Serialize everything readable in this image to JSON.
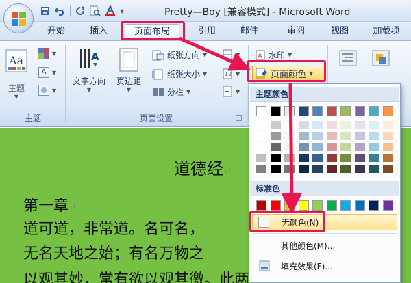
{
  "window": {
    "title": "Pretty—Boy [兼容模式] - Microsoft Word"
  },
  "quick_access": [
    "save-icon",
    "undo-icon",
    "redo-icon",
    "print-preview-icon",
    "font-color-icon"
  ],
  "tabs": [
    {
      "label": "开始",
      "active": false
    },
    {
      "label": "插入",
      "active": false
    },
    {
      "label": "页面布局",
      "active": true
    },
    {
      "label": "引用",
      "active": false
    },
    {
      "label": "邮件",
      "active": false
    },
    {
      "label": "审阅",
      "active": false
    },
    {
      "label": "视图",
      "active": false
    },
    {
      "label": "加载项",
      "active": false
    }
  ],
  "ribbon": {
    "theme_group": {
      "label": "主题",
      "theme_button": "主题"
    },
    "page_setup_group": {
      "label": "页面设置",
      "text_direction": "文字方向",
      "margins": "页边距",
      "orientation": "纸张方向",
      "size": "纸张大小",
      "columns": "分栏"
    },
    "page_bg_group": {
      "watermark": "水印",
      "page_color": "页面颜色"
    }
  },
  "dropdown": {
    "theme_colors_header": "主题颜色",
    "standard_colors_header": "标准色",
    "no_color": "无颜色(N)",
    "more_colors": "其他颜色(M)...",
    "fill_effects": "填充效果(F)...",
    "theme_colors": [
      "#ffffff",
      "#000000",
      "#eeece1",
      "#1f497d",
      "#4f81bd",
      "#c0504d",
      "#9bbb59",
      "#8064a2",
      "#4bacc6",
      "#f79646"
    ],
    "standard_colors": [
      "#c00000",
      "#ff0000",
      "#ffc000",
      "#ffff00",
      "#92d050",
      "#00b050",
      "#00b0f0",
      "#0070c0",
      "#002060",
      "#7030a0"
    ]
  },
  "document": {
    "background_color": "#76c043",
    "heading": "道德经",
    "lines": [
      "第一章",
      "道可道，非常道。名可名，",
      "无名天地之始；有名万物之",
      "以观其妙，常有欲以观其徼。此两者，同"
    ]
  },
  "annotation_color": "#e8154f"
}
